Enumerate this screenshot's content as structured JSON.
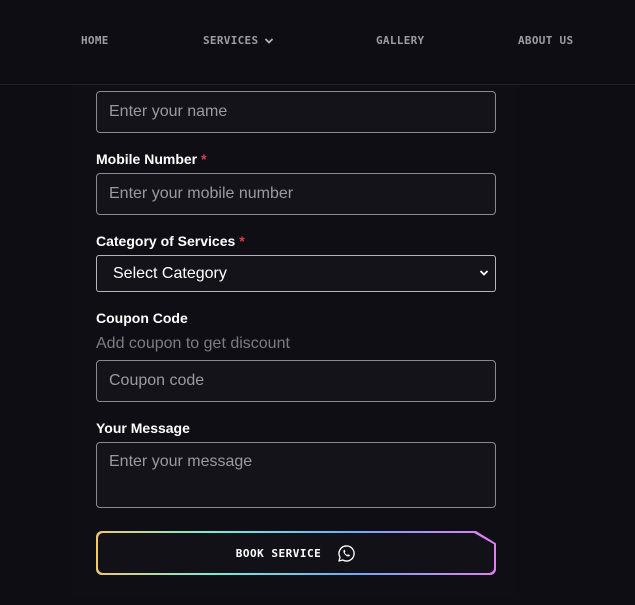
{
  "nav": {
    "home": "HOME",
    "services": "SERVICES",
    "gallery": "GALLERY",
    "about": "ABOUT US"
  },
  "form": {
    "name": {
      "placeholder": "Enter your name",
      "value": ""
    },
    "mobile": {
      "label": "Mobile Number",
      "required_mark": "*",
      "placeholder": "Enter your mobile number",
      "value": ""
    },
    "category": {
      "label": "Category of Services",
      "required_mark": "*",
      "selected": "Select Category"
    },
    "coupon": {
      "label": "Coupon Code",
      "helper": "Add coupon to get discount",
      "placeholder": "Coupon code",
      "value": ""
    },
    "message": {
      "label": "Your Message",
      "placeholder": "Enter your message",
      "value": ""
    },
    "submit": {
      "label": "BOOK SERVICE",
      "icon": "whatsapp-icon"
    }
  },
  "colors": {
    "background": "#0e0d14",
    "required": "#e23b4a",
    "gradient": [
      "#f3c96b",
      "#6ff0d6",
      "#6fa8ff",
      "#e67cf5"
    ]
  }
}
